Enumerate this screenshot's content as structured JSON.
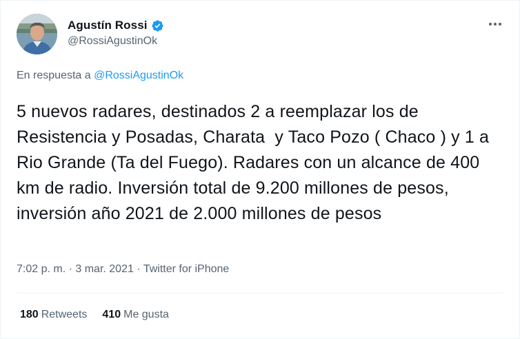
{
  "author": {
    "name": "Agustín Rossi",
    "handle": "@RossiAgustinOk",
    "verified": true
  },
  "reply": {
    "prefix": "En respuesta a",
    "mention": "@RossiAgustinOk"
  },
  "tweet": {
    "text": "5 nuevos radares, destinados 2 a reemplazar los de Resistencia y Posadas, Charata  y Taco Pozo ( Chaco ) y 1 a Rio Grande (Ta del Fuego). Radares con un alcance de 400 km de radio. Inversión total de 9.200 millones de pesos, inversión año 2021 de 2.000 millones de pesos"
  },
  "meta": {
    "time": "7:02 p. m.",
    "sep1": " · ",
    "date": "3 mar. 2021",
    "sep2": " · ",
    "source": "Twitter for iPhone"
  },
  "stats": {
    "retweets_count": "180",
    "retweets_label": "Retweets",
    "likes_count": "410",
    "likes_label": "Me gusta"
  },
  "icons": {
    "verified": "verified-badge-icon",
    "more": "more-options-icon"
  },
  "colors": {
    "accent": "#1d9bf0",
    "text_primary": "#0f1419",
    "text_secondary": "#536471"
  }
}
